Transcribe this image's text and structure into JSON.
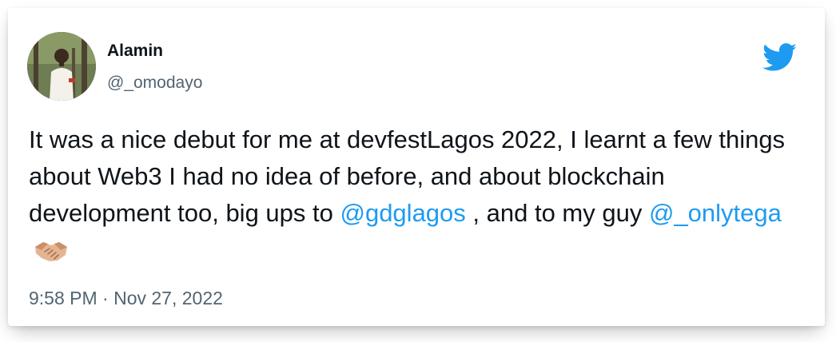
{
  "author": {
    "display_name": "Alamin",
    "handle": "@_omodayo"
  },
  "tweet": {
    "text_1": "It was a nice debut for me at devfestLagos 2022, I learnt a few things about Web3 I had no idea of before, and about blockchain development too, big ups to ",
    "mention_1": "@gdglagos",
    "text_2": " , and to my guy ",
    "mention_2": "@_onlytega",
    "emoji": "handshake-medium-light-skin-tone"
  },
  "meta": {
    "timestamp": "9:58 PM · Nov 27, 2022"
  },
  "icons": {
    "brand": "twitter-bird-icon"
  },
  "colors": {
    "mention": "#1d9bf0",
    "brand": "#1d9bf0",
    "text_primary": "#0f1419",
    "text_secondary": "#536471"
  }
}
